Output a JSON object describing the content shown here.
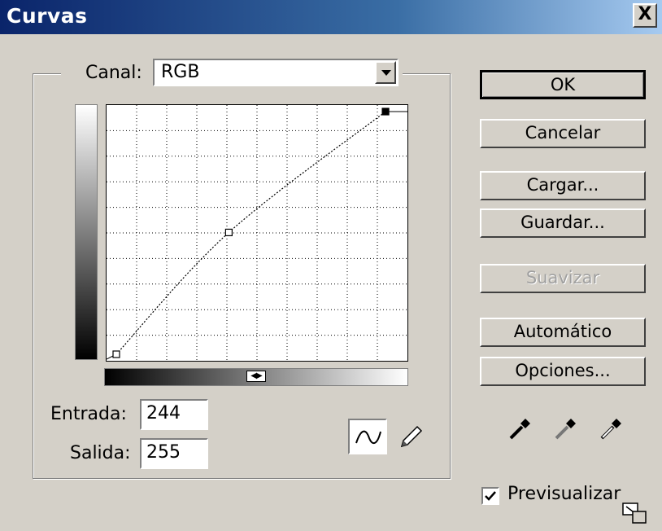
{
  "window": {
    "title": "Curvas",
    "close_label": "X"
  },
  "channel": {
    "label": "Canal:",
    "value": "RGB"
  },
  "curve": {
    "points": [
      [
        0,
        0
      ],
      [
        102,
        128
      ],
      [
        244,
        255
      ]
    ],
    "range": [
      0,
      255
    ]
  },
  "fields": {
    "input_label": "Entrada:",
    "input_value": "244",
    "output_label": "Salida:",
    "output_value": "255"
  },
  "buttons": {
    "ok": "OK",
    "cancel": "Cancelar",
    "load": "Cargar...",
    "save": "Guardar...",
    "smooth": "Suavizar",
    "auto": "Automático",
    "options": "Opciones..."
  },
  "preview": {
    "label": "Previsualizar",
    "checked": true
  },
  "colors": {
    "title_start": "#0a246a",
    "title_end": "#a6caf0",
    "dialog_bg": "#d4d0c8"
  },
  "icons": {
    "curve_tool": "curve-tool-icon",
    "pencil_tool": "pencil-tool-icon",
    "black_eyedropper": "eyedropper-black-icon",
    "gray_eyedropper": "eyedropper-gray-icon",
    "white_eyedropper": "eyedropper-white-icon",
    "expand": "resize-icon"
  }
}
